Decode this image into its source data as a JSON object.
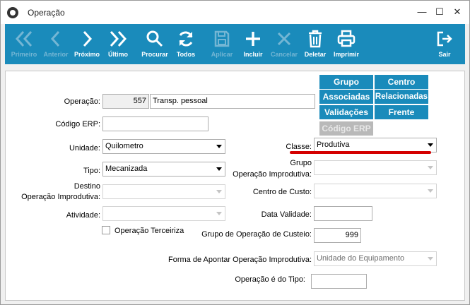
{
  "window": {
    "title": "Operação"
  },
  "toolbar": {
    "first": "Primeiro",
    "previous": "Anterior",
    "next": "Próximo",
    "last": "Último",
    "search": "Procurar",
    "all": "Todos",
    "apply": "Aplicar",
    "add": "Incluir",
    "cancel": "Cancelar",
    "delete": "Deletar",
    "print": "Imprimir",
    "exit": "Sair"
  },
  "buttons": {
    "grupo": "Grupo",
    "centro": "Centro",
    "associadas": "Associadas",
    "relacionadas": "Relacionadas",
    "validacoes": "Validações",
    "frente": "Frente",
    "codigo_erp": "Código ERP"
  },
  "form": {
    "operacao": {
      "label": "Operação:",
      "code": "557",
      "name": "Transp. pessoal"
    },
    "codigo_erp": {
      "label": "Código ERP:",
      "value": ""
    },
    "unidade": {
      "label": "Unidade:",
      "value": "Quilometro"
    },
    "tipo": {
      "label": "Tipo:",
      "value": "Mecanizada"
    },
    "destino": {
      "label_line1": "Destino",
      "label_line2": "Operação Improdutiva:",
      "value": ""
    },
    "atividade": {
      "label": "Atividade:",
      "value": ""
    },
    "terceirizada": {
      "label": "Operação Terceiriza"
    },
    "classe": {
      "label": "Classe:",
      "value": "Produtiva"
    },
    "grupo_op": {
      "label_line1": "Grupo",
      "label_line2": "Operação Improdutiva:",
      "value": ""
    },
    "centro_custo": {
      "label": "Centro de Custo:",
      "value": ""
    },
    "data_validade": {
      "label": "Data Validade:",
      "value": ""
    },
    "grupo_custeio": {
      "label": "Grupo de Operação de Custeio:",
      "value": "999"
    },
    "forma_apontar": {
      "label": "Forma de Apontar Operação Improdutiva:",
      "value": "Unidade do Equipamento"
    },
    "operacao_tipo": {
      "label": "Operação é do Tipo:",
      "value": ""
    }
  },
  "colors": {
    "accent": "#1a8bbb",
    "highlight": "#d40000"
  }
}
